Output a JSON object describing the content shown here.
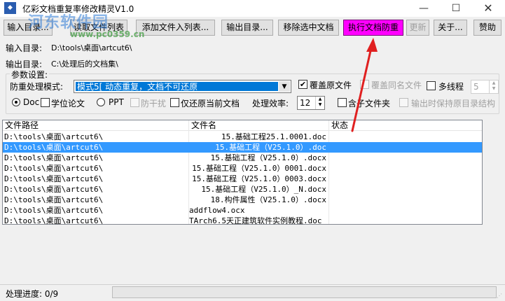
{
  "window": {
    "title": "亿彩文档重复率修改精灵V1.0",
    "watermark": "河东软件园",
    "watermark_url": "www.pc0359.cn",
    "controls": {
      "minimize": "—",
      "maximize": "☐",
      "close": "✕"
    }
  },
  "toolbar": {
    "input_dir": "输入目录...",
    "read_file_list": "读取文件列表",
    "add_file": "添加文件入列表...",
    "output_dir": "输出目录...",
    "remove_selected": "移除选中文档",
    "execute": "执行文档防重",
    "update": "更新",
    "about": "关于...",
    "sponsor": "赞助"
  },
  "paths": {
    "input_label": "输入目录:",
    "input_value": "D:\\tools\\桌面\\artcut6\\",
    "output_label": "输出目录:",
    "output_value": "C:\\处理后的文档集\\"
  },
  "settings": {
    "group_title": "参数设置:",
    "mode_label": "防重处理模式:",
    "mode_value": "模式5[ 动态重复，文档不可还原",
    "overwrite_label": "覆盖原文件",
    "overwrite_checked": true,
    "overwrite_same_name": "覆盖同名文件",
    "multithread": "多线程",
    "thread_count": "5",
    "doc_label": "Doc",
    "thesis_label": "学位论文",
    "ppt_label": "PPT",
    "anti_interference": "防干扰",
    "restore_only": "仅还原当前文档",
    "efficiency_label": "处理效率:",
    "efficiency_value": "12",
    "subfolders": "含子文件夹",
    "keep_structure": "输出时保持原目录结构"
  },
  "table": {
    "headers": [
      "文件路径",
      "文件名",
      "状态"
    ],
    "rows": [
      {
        "path": "D:\\tools\\桌面\\artcut6\\",
        "name": "15.基础工程25.1.0001.doc",
        "status": "",
        "align": "right"
      },
      {
        "path": "D:\\tools\\桌面\\artcut6\\",
        "name": "15.基础工程（V25.1.0）.doc",
        "status": "",
        "align": "right"
      },
      {
        "path": "D:\\tools\\桌面\\artcut6\\",
        "name": "15.基础工程（V25.1.0）.docx",
        "status": "",
        "align": "right"
      },
      {
        "path": "D:\\tools\\桌面\\artcut6\\",
        "name": "15.基础工程（V25.1.0）0001.docx",
        "status": "",
        "align": "right"
      },
      {
        "path": "D:\\tools\\桌面\\artcut6\\",
        "name": "15.基础工程（V25.1.0）0003.docx",
        "status": "",
        "align": "right"
      },
      {
        "path": "D:\\tools\\桌面\\artcut6\\",
        "name": "15.基础工程（V25.1.0）_N.docx",
        "status": "",
        "align": "right"
      },
      {
        "path": "D:\\tools\\桌面\\artcut6\\",
        "name": "18.构件属性（V25.1.0）.docx",
        "status": "",
        "align": "right"
      },
      {
        "path": "D:\\tools\\桌面\\artcut6\\",
        "name": "addflow4.ocx",
        "status": "",
        "align": "left"
      },
      {
        "path": "D:\\tools\\桌面\\artcut6\\",
        "name": "TArch6.5天正建筑软件实例教程.doc",
        "status": "",
        "align": "left"
      }
    ],
    "selected_row": 1
  },
  "status": {
    "progress_label": "处理进度: 0/9"
  },
  "colors": {
    "highlight": "#ff00ff",
    "selection": "#3399ff",
    "arrow": "#e02020"
  }
}
